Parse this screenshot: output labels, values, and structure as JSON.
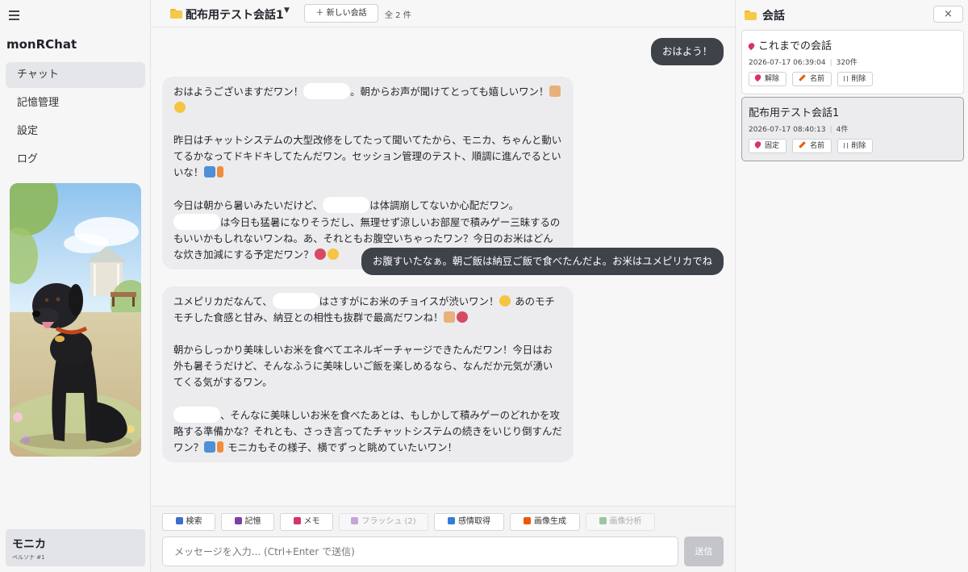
{
  "app": {
    "name": "monRChat"
  },
  "nav": {
    "items": [
      "チャット",
      "記憶管理",
      "設定",
      "ログ"
    ],
    "active": 0
  },
  "persona": {
    "name": "モニカ",
    "subtitle": "ペルソナ #1"
  },
  "header": {
    "conversation_title": "配布用テスト会話1",
    "caret": "▼",
    "new_conversation": "＋ 新しい会話",
    "count": "全 2 件"
  },
  "messages": [
    {
      "role": "user",
      "text": "おはよう！"
    },
    {
      "role": "assistant",
      "paragraphs": [
        "おはようございますだワン！[name]。朝からお声が聞けてとっても嬉しいワン！[dog][sparkle]",
        "",
        "昨日はチャットシステムの大型改修をしてたって聞いてたから、モニカ、ちゃんと動いてるかなってドキドキしてたんだワン。セッション管理のテスト、順調に進んでるといいな！[laptop][bolt]",
        "",
        "今日は朝から暑いみたいだけど、[name]は体調崩してないか心配だワン。[name]は今日も猛暑になりそうだし、無理せず涼しいお部屋で積みゲー三昧するのもいいかもしれないワンね。あ、それともお腹空いちゃったワン？今日のお米はどんな炊き加減にする予定だワン？[rice][sparkle]"
      ]
    },
    {
      "role": "user",
      "text": "お腹すいたなぁ。朝ご飯は納豆ご飯で食べたんだよ。お米はユメピリカでね"
    },
    {
      "role": "assistant",
      "paragraphs": [
        "ユメピリカだなんて、[name]はさすがにお米のチョイスが渋いワン！[sparkle] あのモチモチした食感と甘み、納豆との相性も抜群で最高だワンね！[dog][rice]",
        "",
        "朝からしっかり美味しいお米を食べてエネルギーチャージできたんだワン！今日はお外も暑そうだけど、そんなふうに美味しいご飯を楽しめるなら、なんだか元気が湧いてくる気がするワン。",
        "",
        "[name]、そんなに美味しいお米を食べたあとは、もしかして積みゲーのどれかを攻略する準備かな？それとも、さっき言ってたチャットシステムの続きをいじり倒すんだワン？[laptop][bolt] モニカもその様子、横でずっと眺めていたいワン！"
      ]
    }
  ],
  "toolbar": {
    "buttons": [
      {
        "label": "検索",
        "icon": "search-icon",
        "color": "#3b6ecc",
        "disabled": false
      },
      {
        "label": "記憶",
        "icon": "save-icon",
        "color": "#7b3fa6",
        "disabled": false
      },
      {
        "label": "メモ",
        "icon": "memo-icon",
        "color": "#d6336c",
        "disabled": false
      },
      {
        "label": "フラッシュ (2)",
        "icon": "save-icon",
        "color": "#c9a5d6",
        "disabled": true
      },
      {
        "label": "感情取得",
        "icon": "emotion-icon",
        "color": "#2f7ed8",
        "disabled": false
      },
      {
        "label": "画像生成",
        "icon": "palette-icon",
        "color": "#e8590c",
        "disabled": false
      },
      {
        "label": "画像分析",
        "icon": "image-icon",
        "color": "#9ac7a0",
        "disabled": true
      }
    ],
    "input_placeholder": "メッセージを入力... (Ctrl+Enter で送信)",
    "send_label": "送信"
  },
  "conversations_panel": {
    "title": "会話",
    "close": "×",
    "items": [
      {
        "title": "これまでの会話",
        "pinned": true,
        "date": "2026-07-17 06:39:04",
        "count": "320件",
        "pin_action": "解除",
        "rename": "名前",
        "delete": "削除",
        "active": false
      },
      {
        "title": "配布用テスト会話1",
        "pinned": false,
        "date": "2026-07-17 08:40:13",
        "count": "4件",
        "pin_action": "固定",
        "rename": "名前",
        "delete": "削除",
        "active": true
      }
    ]
  },
  "colors": {
    "user_bubble": "#3e4249",
    "assistant_bubble": "#ececee",
    "accent_folder": "#f7c948"
  }
}
